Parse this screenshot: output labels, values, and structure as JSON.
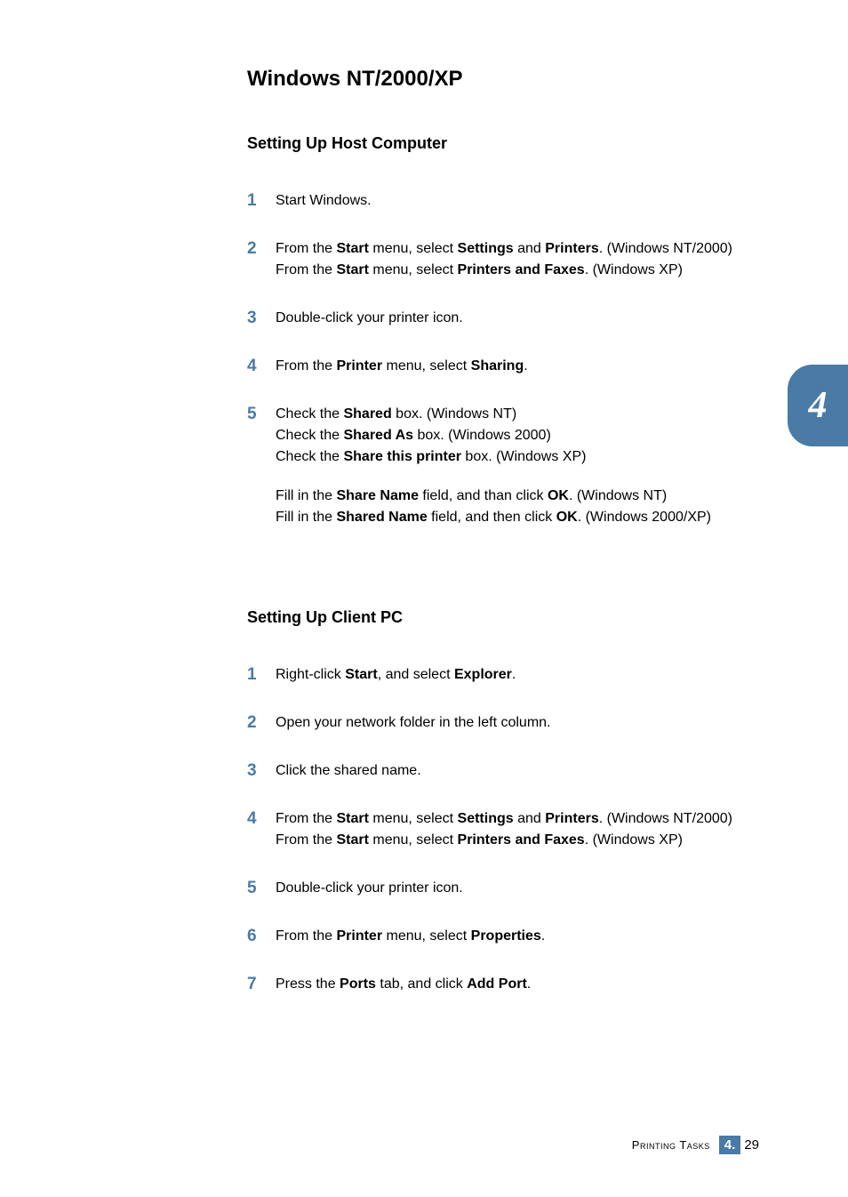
{
  "headings": {
    "main": "Windows NT/2000/XP",
    "host": "Setting Up Host Computer",
    "client": "Setting Up Client PC"
  },
  "host_steps": {
    "s1": {
      "num": "1",
      "text": "Start Windows."
    },
    "s2": {
      "num": "2",
      "p1a": "From the ",
      "p1b": "Start",
      "p1c": " menu, select ",
      "p1d": "Settings",
      "p1e": " and ",
      "p1f": "Printers",
      "p1g": ". (Windows NT/2000)",
      "p2a": "From the ",
      "p2b": "Start",
      "p2c": " menu, select ",
      "p2d": "Printers and Faxes",
      "p2e": ". (Windows XP)"
    },
    "s3": {
      "num": "3",
      "text": "Double-click your printer icon."
    },
    "s4": {
      "num": "4",
      "a": "From the ",
      "b": "Printer",
      "c": " menu, select ",
      "d": "Sharing",
      "e": "."
    },
    "s5": {
      "num": "5",
      "l1a": "Check the ",
      "l1b": "Shared",
      "l1c": " box. (Windows NT)",
      "l2a": "Check the ",
      "l2b": "Shared As",
      "l2c": " box. (Windows 2000)",
      "l3a": "Check the ",
      "l3b": "Share this printer",
      "l3c": " box. (Windows XP)",
      "p2l1a": "Fill in the ",
      "p2l1b": "Share Name",
      "p2l1c": " field, and than click ",
      "p2l1d": "OK",
      "p2l1e": ". (Windows NT)",
      "p2l2a": "Fill in the ",
      "p2l2b": "Shared Name",
      "p2l2c": " field, and then click ",
      "p2l2d": "OK",
      "p2l2e": ". (Windows 2000/XP)"
    }
  },
  "client_steps": {
    "s1": {
      "num": "1",
      "a": "Right-click ",
      "b": "Start",
      "c": ", and select ",
      "d": "Explorer",
      "e": "."
    },
    "s2": {
      "num": "2",
      "text": "Open your network folder in the left column."
    },
    "s3": {
      "num": "3",
      "text": "Click the shared name."
    },
    "s4": {
      "num": "4",
      "p1a": "From the ",
      "p1b": "Start",
      "p1c": " menu, select ",
      "p1d": "Settings",
      "p1e": " and ",
      "p1f": "Printers",
      "p1g": ". (Windows NT/2000)",
      "p2a": "From the ",
      "p2b": "Start",
      "p2c": " menu, select ",
      "p2d": "Printers and Faxes",
      "p2e": ". (Windows XP)"
    },
    "s5": {
      "num": "5",
      "text": "Double-click your printer icon."
    },
    "s6": {
      "num": "6",
      "a": "From the ",
      "b": "Printer",
      "c": " menu, select ",
      "d": "Properties",
      "e": "."
    },
    "s7": {
      "num": "7",
      "a": "Press the ",
      "b": "Ports",
      "c": " tab, and click ",
      "d": "Add Port",
      "e": "."
    }
  },
  "side_tab": {
    "num": "4"
  },
  "footer": {
    "title": "Printing Tasks",
    "chapter": "4.",
    "page": "29"
  }
}
